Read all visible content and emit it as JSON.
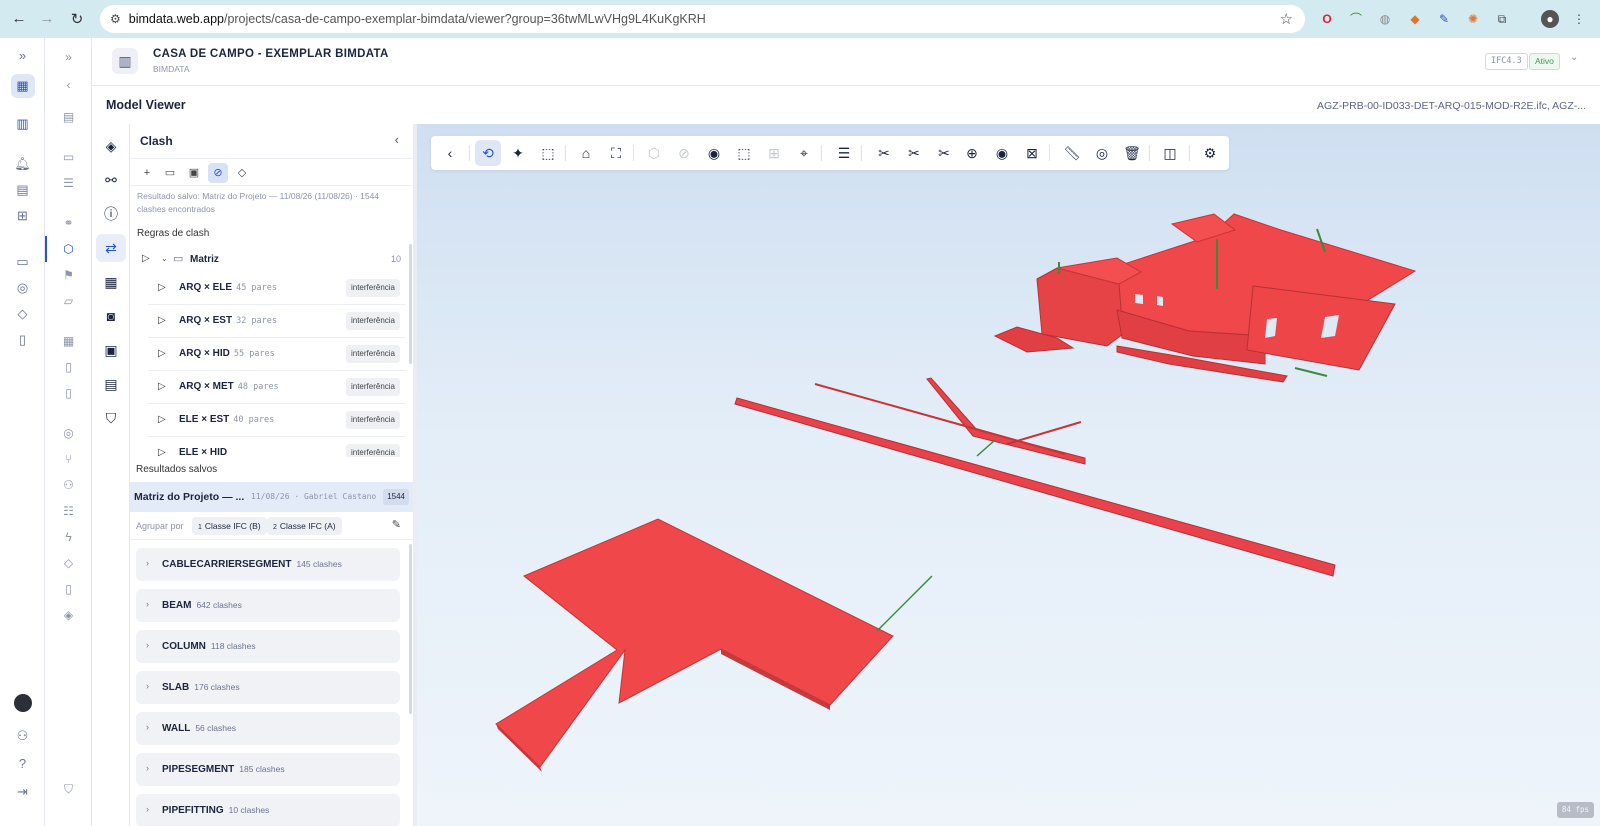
{
  "browser": {
    "url_host": "bimdata.web.app",
    "url_path": "/projects/casa-de-campo-exemplar-bimdata/viewer?group=36twMLwVHg9L4KuKgKRH"
  },
  "header": {
    "project_title": "CASA DE CAMPO - EXEMPLAR BIMDATA",
    "project_subtitle": "BIMDATA",
    "ifc_badge": "IFC4.3",
    "status_badge": "Ativo"
  },
  "subheader": {
    "title": "Model Viewer",
    "file": "AGZ-PRB-00-ID033-DET-ARQ-015-MOD-R2E.ifc, AGZ-..."
  },
  "clash_panel": {
    "title": "Clash",
    "saved_note": "Resultado salvo: Matriz do Projeto — 11/08/26 (11/08/26) · 1544 clashes encontrados",
    "rules_label": "Regras de clash",
    "matrix": {
      "name": "Matriz",
      "count": "10"
    },
    "rules": [
      {
        "name": "ARQ × ELE",
        "pairs": "45 pares",
        "tag": "interferência"
      },
      {
        "name": "ARQ × EST",
        "pairs": "32 pares",
        "tag": "interferência"
      },
      {
        "name": "ARQ × HID",
        "pairs": "55 pares",
        "tag": "interferência"
      },
      {
        "name": "ARQ × MET",
        "pairs": "48 pares",
        "tag": "interferência"
      },
      {
        "name": "ELE × EST",
        "pairs": "40 pares",
        "tag": "interferência"
      },
      {
        "name": "ELE × HID",
        "pairs": "",
        "tag": "interferência"
      }
    ],
    "results_label": "Resultados salvos",
    "saved_result": {
      "name": "Matriz do Projeto — ...",
      "meta": "11/08/26 · Gabriel Castano",
      "count": "1544"
    },
    "group_by": {
      "label": "Agrupar por",
      "chip1_n": "1",
      "chip1": "Classe IFC (B)",
      "chip2_n": "2",
      "chip2": "Classe IFC (A)"
    },
    "groups": [
      {
        "name": "CABLECARRIERSEGMENT",
        "count": "145 clashes"
      },
      {
        "name": "BEAM",
        "count": "642 clashes"
      },
      {
        "name": "COLUMN",
        "count": "118 clashes"
      },
      {
        "name": "SLAB",
        "count": "176 clashes"
      },
      {
        "name": "WALL",
        "count": "56 clashes"
      },
      {
        "name": "PIPESEGMENT",
        "count": "185 clashes"
      },
      {
        "name": "PIPEFITTING",
        "count": "10 clashes"
      }
    ]
  },
  "viewer": {
    "fps": "84 fps",
    "colors": {
      "clash_red": "#f0474a",
      "accent": "#2456c9",
      "pipe_green": "#3a8a3e"
    }
  }
}
